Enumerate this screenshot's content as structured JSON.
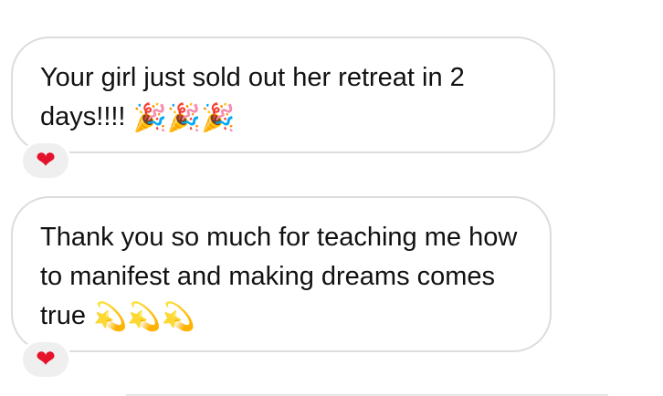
{
  "messages": [
    {
      "text": "Your girl just sold out her retreat in 2 days!!!! ",
      "emoji": "🎉🎉🎉",
      "reaction": "❤"
    },
    {
      "text": "Thank you so much for teaching me how to manifest and making dreams comes true ",
      "emoji": "💫💫💫",
      "reaction": "❤"
    }
  ],
  "colors": {
    "bubble_border": "#dcdcdc",
    "reaction_bg": "#efefef",
    "heart": "#e5122b"
  },
  "icons": [
    "party-popper-icon",
    "dizzy-icon",
    "heart-icon"
  ]
}
